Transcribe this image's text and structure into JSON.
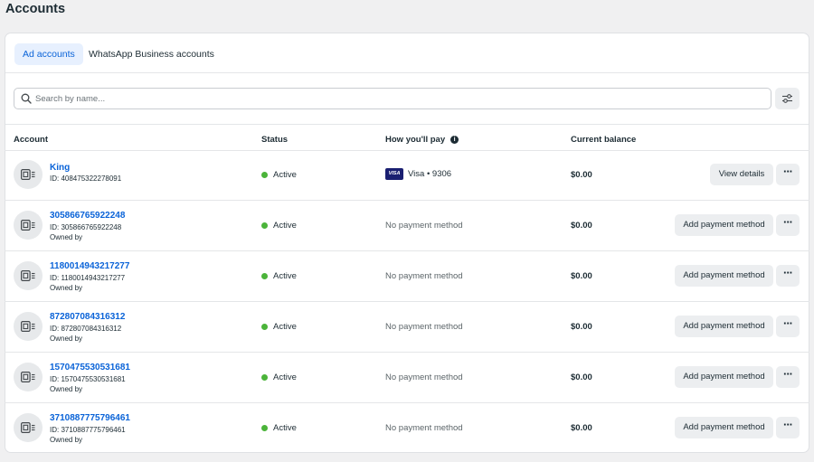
{
  "page": {
    "title": "Accounts"
  },
  "tabs": [
    {
      "label": "Ad accounts",
      "active": true
    },
    {
      "label": "WhatsApp Business accounts",
      "active": false
    }
  ],
  "search": {
    "placeholder": "Search by name..."
  },
  "columns": {
    "account": "Account",
    "status": "Status",
    "pay": "How you'll pay",
    "balance": "Current balance"
  },
  "icons": {
    "search": "search-icon",
    "filter": "sliders-icon",
    "info": "info-icon",
    "avatar": "ad-account-icon",
    "more": "more-horizontal-icon",
    "card": "visa-card-icon"
  },
  "colors": {
    "accent": "#0a63d8",
    "active": "#4bb43a",
    "visa": "#1a1f71"
  },
  "accounts": [
    {
      "name": "King",
      "id_text": "ID: 408475322278091",
      "owned_by": "",
      "status": "Active",
      "payment_brand": "VISA",
      "payment": "Visa • 9306",
      "balance": "$0.00",
      "action": "View details"
    },
    {
      "name": "305866765922248",
      "id_text": "ID: 305866765922248",
      "owned_by": "Owned by",
      "status": "Active",
      "payment": "No payment method",
      "balance": "$0.00",
      "action": "Add payment method"
    },
    {
      "name": "1180014943217277",
      "id_text": "ID: 1180014943217277",
      "owned_by": "Owned by",
      "status": "Active",
      "payment": "No payment method",
      "balance": "$0.00",
      "action": "Add payment method"
    },
    {
      "name": "872807084316312",
      "id_text": "ID: 872807084316312",
      "owned_by": "Owned by",
      "status": "Active",
      "payment": "No payment method",
      "balance": "$0.00",
      "action": "Add payment method"
    },
    {
      "name": "1570475530531681",
      "id_text": "ID: 1570475530531681",
      "owned_by": "Owned by",
      "status": "Active",
      "payment": "No payment method",
      "balance": "$0.00",
      "action": "Add payment method"
    },
    {
      "name": "3710887775796461",
      "id_text": "ID: 3710887775796461",
      "owned_by": "Owned by",
      "status": "Active",
      "payment": "No payment method",
      "balance": "$0.00",
      "action": "Add payment method"
    }
  ]
}
